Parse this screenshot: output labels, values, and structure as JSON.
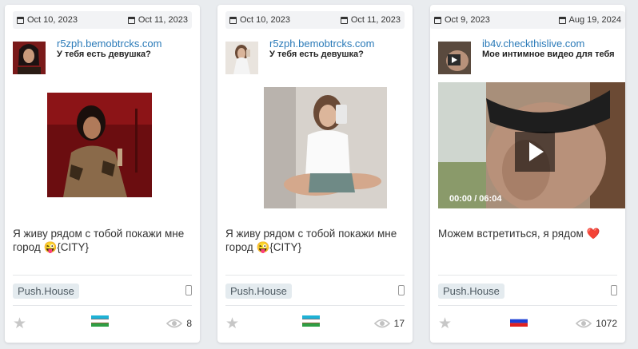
{
  "cards": [
    {
      "date_start": "Oct 10, 2023",
      "date_end": "Oct 11, 2023",
      "domain": "r5zph.bemobtrcks.com",
      "title": "У тебя есть девушка?",
      "text": "Я живу рядом с тобой покажи мне город 😜{CITY}",
      "tag": "Push.House",
      "flag": "uzbekistan-flag",
      "views": "8"
    },
    {
      "date_start": "Oct 10, 2023",
      "date_end": "Oct 11, 2023",
      "domain": "r5zph.bemobtrcks.com",
      "title": "У тебя есть девушка?",
      "text": "Я живу рядом с тобой покажи мне город 😜{CITY}",
      "tag": "Push.House",
      "flag": "uzbekistan-flag",
      "views": "17"
    },
    {
      "date_start": "Oct 9, 2023",
      "date_end": "Aug 19, 2024",
      "domain": "ib4v.checkthislive.com",
      "title": "Мое интимное видео для тебя",
      "text": "Можем встретиться, я рядом ❤️",
      "tag": "Push.House",
      "flag": "russia-flag",
      "views": "1072",
      "video_time": "00:00 / 06:04"
    }
  ],
  "colors": {
    "domain_link": "#2a7ab8",
    "tag_bg": "#e4ebef",
    "background": "#e9ecef"
  }
}
